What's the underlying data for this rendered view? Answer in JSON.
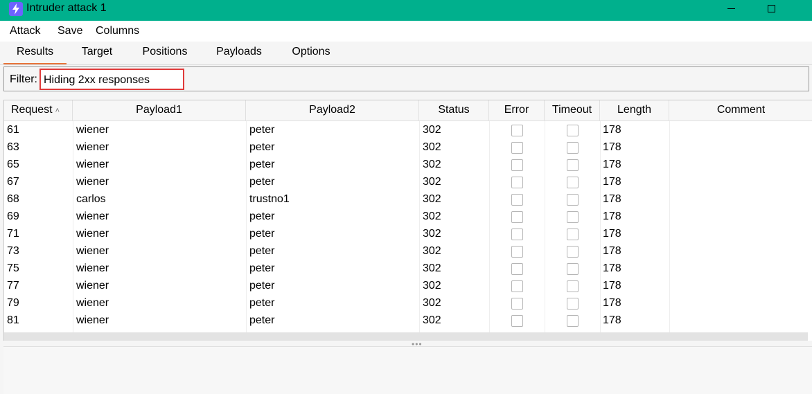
{
  "window": {
    "title": "Intruder attack 1"
  },
  "menu": [
    "Attack",
    "Save",
    "Columns"
  ],
  "tabs": [
    "Results",
    "Target",
    "Positions",
    "Payloads",
    "Options"
  ],
  "active_tab": "Results",
  "filter": {
    "label": "Filter:",
    "value": "Hiding 2xx responses"
  },
  "table": {
    "columns": [
      "Request",
      "Payload1",
      "Payload2",
      "Status",
      "Error",
      "Timeout",
      "Length",
      "Comment"
    ],
    "sorted_column": "Request",
    "rows": [
      {
        "request": "61",
        "payload1": "wiener",
        "payload2": "peter",
        "status": "302",
        "error": false,
        "timeout": false,
        "length": "178",
        "comment": ""
      },
      {
        "request": "63",
        "payload1": "wiener",
        "payload2": "peter",
        "status": "302",
        "error": false,
        "timeout": false,
        "length": "178",
        "comment": ""
      },
      {
        "request": "65",
        "payload1": "wiener",
        "payload2": "peter",
        "status": "302",
        "error": false,
        "timeout": false,
        "length": "178",
        "comment": ""
      },
      {
        "request": "67",
        "payload1": "wiener",
        "payload2": "peter",
        "status": "302",
        "error": false,
        "timeout": false,
        "length": "178",
        "comment": ""
      },
      {
        "request": "68",
        "payload1": "carlos",
        "payload2": "trustno1",
        "status": "302",
        "error": false,
        "timeout": false,
        "length": "178",
        "comment": ""
      },
      {
        "request": "69",
        "payload1": "wiener",
        "payload2": "peter",
        "status": "302",
        "error": false,
        "timeout": false,
        "length": "178",
        "comment": ""
      },
      {
        "request": "71",
        "payload1": "wiener",
        "payload2": "peter",
        "status": "302",
        "error": false,
        "timeout": false,
        "length": "178",
        "comment": ""
      },
      {
        "request": "73",
        "payload1": "wiener",
        "payload2": "peter",
        "status": "302",
        "error": false,
        "timeout": false,
        "length": "178",
        "comment": ""
      },
      {
        "request": "75",
        "payload1": "wiener",
        "payload2": "peter",
        "status": "302",
        "error": false,
        "timeout": false,
        "length": "178",
        "comment": ""
      },
      {
        "request": "77",
        "payload1": "wiener",
        "payload2": "peter",
        "status": "302",
        "error": false,
        "timeout": false,
        "length": "178",
        "comment": ""
      },
      {
        "request": "79",
        "payload1": "wiener",
        "payload2": "peter",
        "status": "302",
        "error": false,
        "timeout": false,
        "length": "178",
        "comment": ""
      },
      {
        "request": "81",
        "payload1": "wiener",
        "payload2": "peter",
        "status": "302",
        "error": false,
        "timeout": false,
        "length": "178",
        "comment": ""
      }
    ]
  },
  "colors": {
    "titlebar": "#00b08d",
    "active_tab_underline": "#e8743b",
    "filter_highlight": "#e03a3a",
    "app_icon": "#6c63ff"
  },
  "icons": {
    "app": "lightning-icon",
    "minimize": "minimize-icon",
    "maximize": "maximize-icon",
    "sort": "sort-ascending-icon"
  }
}
